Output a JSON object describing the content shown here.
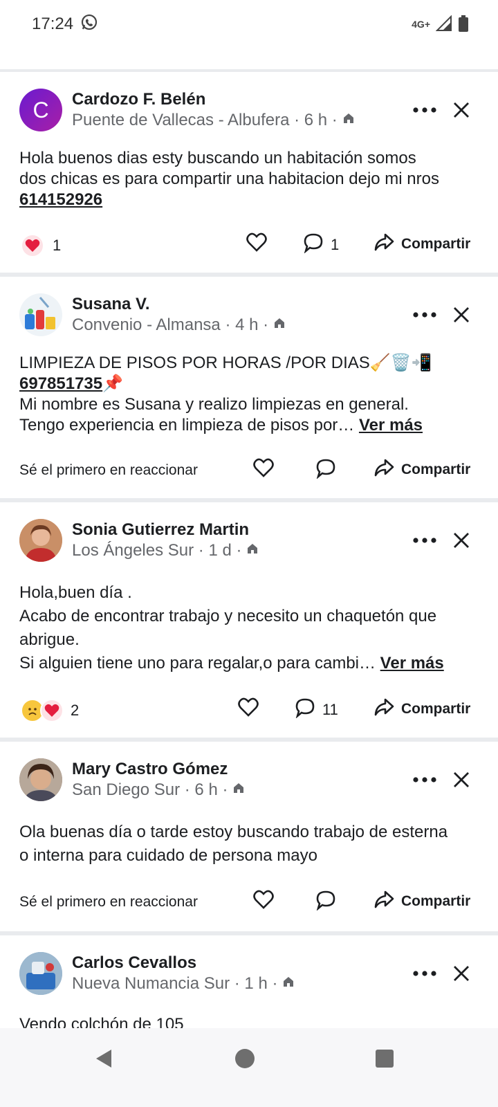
{
  "status_bar": {
    "time": "17:24",
    "network": "4G+"
  },
  "posts": [
    {
      "avatar_letter": "C",
      "author": "Cardozo F. Belén",
      "meta": "Puente de Vallecas - Albufera · 6 h ·",
      "text_lines": [
        "Hola buenos dias  esty buscando un habitación  somos",
        "dos chicas es para compartir una habitacion  dejo mi nros"
      ],
      "phone": "614152926",
      "reaction_count": "1",
      "comment_count": "1",
      "share_label": "Compartir"
    },
    {
      "author": "Susana V.",
      "meta": "Convenio - Almansa · 4 h ·",
      "text_line1": "LIMPIEZA DE PISOS POR HORAS /POR DIAS🧹🗑️📲",
      "phone": "697851735",
      "phone_emoji": "📌",
      "text_line3": "Mi nombre es Susana y realizo limpiezas en general.",
      "text_line4": "Tengo experiencia en limpieza de pisos por…",
      "see_more": "Ver más",
      "first_reaction": "Sé el primero en reaccionar",
      "share_label": "Compartir"
    },
    {
      "author": "Sonia Gutierrez Martin",
      "meta": "Los Ángeles Sur · 1 d ·",
      "text_lines": [
        "Hola,buen día .",
        "Acabo de encontrar trabajo y necesito un chaquetón que",
        "abrigue."
      ],
      "text_last": "Si alguien tiene uno para regalar,o para cambi…",
      "see_more": "Ver más",
      "reaction_count": "2",
      "comment_count": "11",
      "share_label": "Compartir"
    },
    {
      "author": "Mary Castro Gómez",
      "meta": "San Diego Sur · 6 h ·",
      "text_lines": [
        "Ola buenas día o tarde estoy buscando trabajo de esterna",
        "o interna para cuidado de persona mayo"
      ],
      "first_reaction": "Sé el primero en reaccionar",
      "share_label": "Compartir"
    },
    {
      "author": "Carlos Cevallos",
      "meta": "Nueva Numancia Sur · 1 h ·",
      "text_lines": [
        "Vendo colchón de 105"
      ]
    }
  ],
  "colors": {
    "accent": "#1877f2",
    "secondary_text": "#65676b",
    "love_red": "#f33e58"
  }
}
